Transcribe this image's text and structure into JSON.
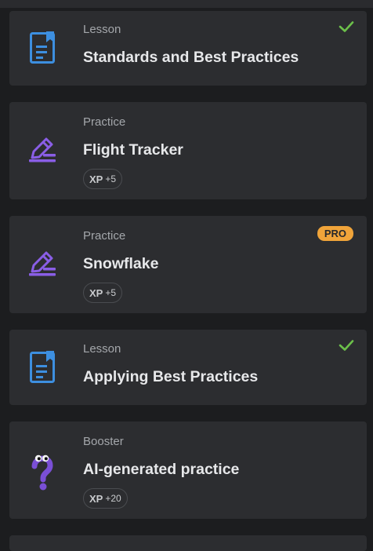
{
  "colors": {
    "lesson_icon": "#3d8fe0",
    "practice_icon": "#8a5ee6",
    "booster_icon": "#7a4fd6",
    "check": "#6cc04a",
    "pro_badge": "#f0a43a",
    "card_bg": "#2c2d30",
    "page_bg": "#1c1d1f"
  },
  "items": [
    {
      "type": "Lesson",
      "title": "Standards and Best Practices",
      "icon": "lesson-book-icon",
      "completed": true
    },
    {
      "type": "Practice",
      "title": "Flight Tracker",
      "icon": "pencil-icon",
      "xp_label": "XP",
      "xp_value": "+5"
    },
    {
      "type": "Practice",
      "title": "Snowflake",
      "icon": "pencil-icon",
      "xp_label": "XP",
      "xp_value": "+5",
      "badge": "PRO"
    },
    {
      "type": "Lesson",
      "title": "Applying Best Practices",
      "icon": "lesson-book-icon",
      "completed": true
    },
    {
      "type": "Booster",
      "title": "AI-generated practice",
      "icon": "question-mascot-icon",
      "xp_label": "XP",
      "xp_value": "+20"
    }
  ]
}
